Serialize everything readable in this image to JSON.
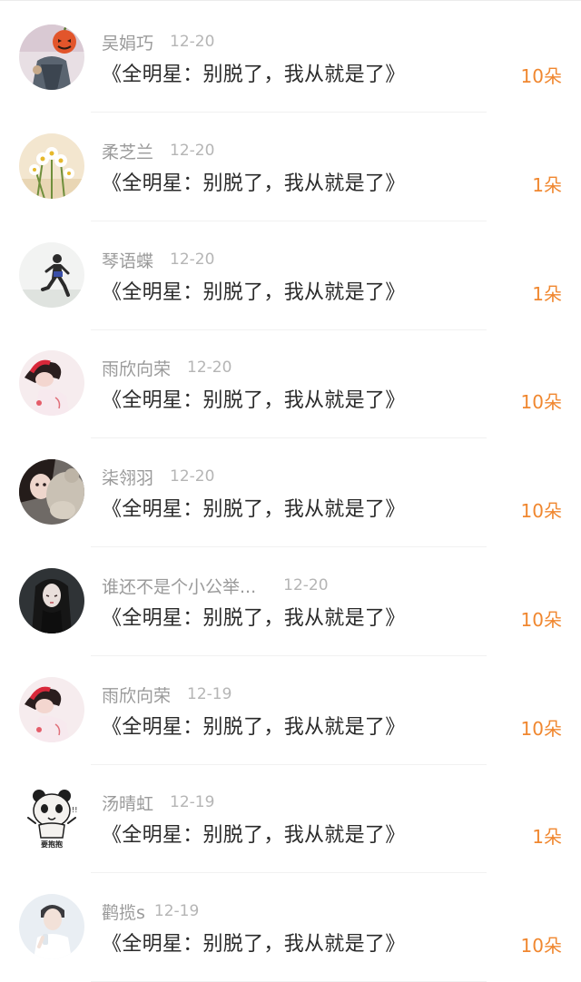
{
  "items": [
    {
      "name": "吴娟巧",
      "date": "12-20",
      "title": "《全明星：别脱了，我从就是了》",
      "count": "10朵",
      "avatar_icon": "avatar-pumpkin-girl-icon"
    },
    {
      "name": "柔芝兰",
      "date": "12-20",
      "title": "《全明星：别脱了，我从就是了》",
      "count": "1朵",
      "avatar_icon": "avatar-daisy-flowers-icon"
    },
    {
      "name": "琴语蝶",
      "date": "12-20",
      "title": "《全明星：别脱了，我从就是了》",
      "count": "1朵",
      "avatar_icon": "avatar-runner-icon"
    },
    {
      "name": "雨欣向荣",
      "date": "12-20",
      "title": "《全明星：别脱了，我从就是了》",
      "count": "10朵",
      "avatar_icon": "avatar-girl-red-icon"
    },
    {
      "name": "柒翎羽",
      "date": "12-20",
      "title": "《全明星：别脱了，我从就是了》",
      "count": "10朵",
      "avatar_icon": "avatar-girl-teddy-icon"
    },
    {
      "name": "谁还不是个小公举...",
      "date": "12-20",
      "title": "《全明星：别脱了，我从就是了》",
      "count": "10朵",
      "avatar_icon": "avatar-dark-girl-icon"
    },
    {
      "name": "雨欣向荣",
      "date": "12-19",
      "title": "《全明星：别脱了，我从就是了》",
      "count": "10朵",
      "avatar_icon": "avatar-girl-red-icon"
    },
    {
      "name": "汤晴虹",
      "date": "12-19",
      "title": "《全明星：别脱了，我从就是了》",
      "count": "1朵",
      "avatar_icon": "avatar-panda-sticker-icon",
      "avatar_text": "要抱抱"
    },
    {
      "name": "鹳揽s",
      "date": "12-19",
      "title": "《全明星：别脱了，我从就是了》",
      "count": "10朵",
      "avatar_icon": "avatar-boy-white-icon"
    }
  ],
  "colors": {
    "name": "#9a9a9a",
    "date": "#b5b5b5",
    "title": "#2a2a2a",
    "count": "#f0872f"
  }
}
